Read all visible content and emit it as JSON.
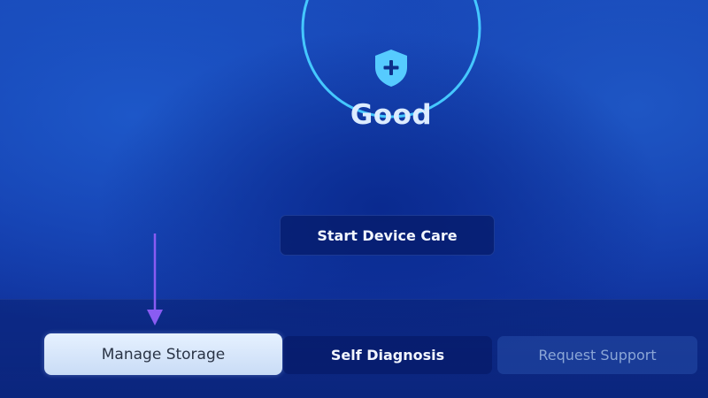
{
  "device_care": {
    "status": "Good",
    "start_button_label": "Start Device Care"
  },
  "bottom_menu": {
    "manage_storage_label": "Manage Storage",
    "self_diagnosis_label": "Self Diagnosis",
    "request_support_label": "Request Support"
  },
  "icons": {
    "status_icon": "shield-plus-icon",
    "annotation": "arrow-down-icon"
  },
  "colors": {
    "accent": "#45c8ff",
    "background": "#1848b8",
    "focused_button": "#e6f1ff",
    "disabled_text": "#8ba6d6"
  }
}
